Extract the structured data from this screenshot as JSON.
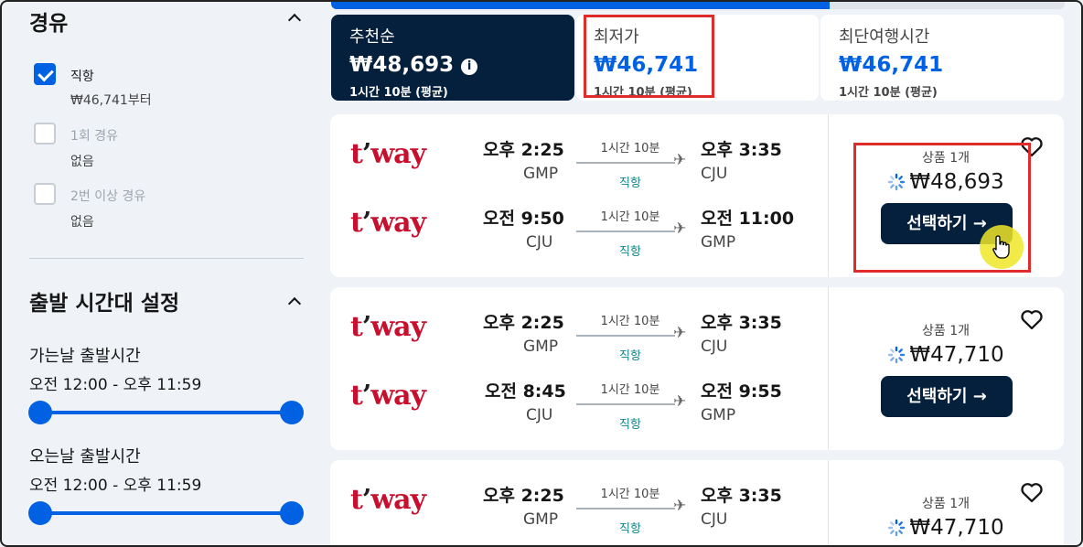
{
  "filters": {
    "stops": {
      "title": "경유",
      "options": [
        {
          "label": "직항",
          "sub": "₩46,741부터",
          "checked": true,
          "disabled": false
        },
        {
          "label": "1회 경유",
          "sub": "없음",
          "checked": false,
          "disabled": true
        },
        {
          "label": "2번 이상 경유",
          "sub": "없음",
          "checked": false,
          "disabled": true
        }
      ]
    },
    "departure_time": {
      "title": "출발 시간대 설정",
      "outbound": {
        "label": "가는날 출발시간",
        "range": "오전 12:00 - 오후 11:59"
      },
      "inbound": {
        "label": "오는날 출발시간",
        "range": "오전 12:00 - 오후 11:59"
      }
    }
  },
  "progress": {
    "fraction": 0.68
  },
  "sort_tabs": [
    {
      "title": "추천순",
      "price": "₩48,693",
      "sub": "1시간 10분 (평균)",
      "active": true
    },
    {
      "title": "최저가",
      "price": "₩46,741",
      "sub": "1시간 10분 (평균)",
      "active": false
    },
    {
      "title": "최단여행시간",
      "price": "₩46,741",
      "sub": "1시간 10분 (평균)",
      "active": false
    }
  ],
  "results": [
    {
      "airline": "t'way",
      "legs": [
        {
          "dep_time": "오후 2:25",
          "dep_airport": "GMP",
          "duration": "1시간 10분",
          "stops": "직항",
          "arr_time": "오후 3:35",
          "arr_airport": "CJU"
        },
        {
          "dep_time": "오전 9:50",
          "dep_airport": "CJU",
          "duration": "1시간 10분",
          "stops": "직항",
          "arr_time": "오전 11:00",
          "arr_airport": "GMP"
        }
      ],
      "qty": "상품 1개",
      "price": "₩48,693",
      "select_label": "선택하기 →"
    },
    {
      "airline": "t'way",
      "legs": [
        {
          "dep_time": "오후 2:25",
          "dep_airport": "GMP",
          "duration": "1시간 10분",
          "stops": "직항",
          "arr_time": "오후 3:35",
          "arr_airport": "CJU"
        },
        {
          "dep_time": "오전 8:45",
          "dep_airport": "CJU",
          "duration": "1시간 10분",
          "stops": "직항",
          "arr_time": "오전 9:55",
          "arr_airport": "GMP"
        }
      ],
      "qty": "상품 1개",
      "price": "₩47,710",
      "select_label": "선택하기 →"
    },
    {
      "airline": "t'way",
      "legs": [
        {
          "dep_time": "오후 2:25",
          "dep_airport": "GMP",
          "duration": "1시간 10분",
          "stops": "직항",
          "arr_time": "오후 3:35",
          "arr_airport": "CJU"
        }
      ],
      "qty": "상품 1개",
      "price": "₩47,710"
    }
  ],
  "icons": {
    "chevron": "chevron-up-icon",
    "info": "info-icon",
    "heart": "heart-icon",
    "plane": "airplane-icon",
    "loading": "loading-spinner-icon",
    "cursor": "hand-cursor-icon"
  },
  "colors": {
    "accent": "#0062e3",
    "dark": "#05203c",
    "direct": "#0c838a",
    "annotation": "#e02b2b",
    "airline_red": "#c8102e"
  }
}
